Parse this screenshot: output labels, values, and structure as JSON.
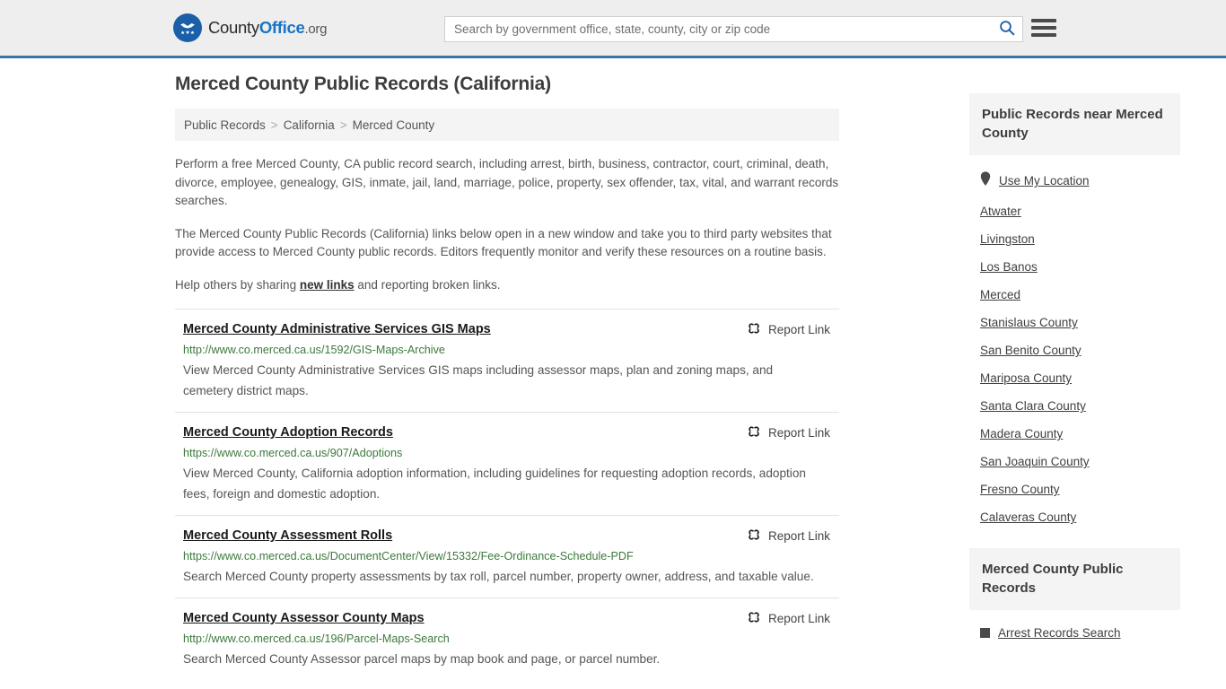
{
  "header": {
    "logo": {
      "part1": "County",
      "part2": "Office",
      "part3": ".org",
      "icon": "eagle-shield-logo-icon"
    },
    "search": {
      "placeholder": "Search by government office, state, county, city or zip code",
      "value": "",
      "button_icon": "search-icon"
    },
    "menu_icon": "hamburger-menu-icon",
    "accent_color": "#3a74a8",
    "background_color": "#eeeeee"
  },
  "main": {
    "title": "Merced County Public Records (California)",
    "breadcrumb": {
      "items": [
        "Public Records",
        "California",
        "Merced County"
      ],
      "separator": ">"
    },
    "intro_paragraph_1": "Perform a free Merced County, CA public record search, including arrest, birth, business, contractor, court, criminal, death, divorce, employee, genealogy, GIS, inmate, jail, land, marriage, police, property, sex offender, tax, vital, and warrant records searches.",
    "intro_paragraph_2": "The Merced County Public Records (California) links below open in a new window and take you to third party websites that provide access to Merced County public records. Editors frequently monitor and verify these resources on a routine basis.",
    "help_prefix": "Help others by sharing ",
    "help_link": "new links",
    "help_suffix": " and reporting broken links.",
    "report_link_label": "Report Link",
    "report_link_icon": "broken-chain-icon",
    "records": [
      {
        "title": "Merced County Administrative Services GIS Maps",
        "url": "http://www.co.merced.ca.us/1592/GIS-Maps-Archive",
        "description": "View Merced County Administrative Services GIS maps including assessor maps, plan and zoning maps, and cemetery district maps."
      },
      {
        "title": "Merced County Adoption Records",
        "url": "https://www.co.merced.ca.us/907/Adoptions",
        "description": "View Merced County, California adoption information, including guidelines for requesting adoption records, adoption fees, foreign and domestic adoption."
      },
      {
        "title": "Merced County Assessment Rolls",
        "url": "https://www.co.merced.ca.us/DocumentCenter/View/15332/Fee-Ordinance-Schedule-PDF",
        "description": "Search Merced County property assessments by tax roll, parcel number, property owner, address, and taxable value."
      },
      {
        "title": "Merced County Assessor County Maps",
        "url": "http://www.co.merced.ca.us/196/Parcel-Maps-Search",
        "description": "Search Merced County Assessor parcel maps by map book and page, or parcel number."
      }
    ]
  },
  "sidebar": {
    "nearby": {
      "title": "Public Records near Merced County",
      "use_my_location": "Use My Location",
      "location_icon": "map-pin-icon",
      "places": [
        "Atwater",
        "Livingston",
        "Los Banos",
        "Merced",
        "Stanislaus County",
        "San Benito County",
        "Mariposa County",
        "Santa Clara County",
        "Madera County",
        "San Joaquin County",
        "Fresno County",
        "Calaveras County"
      ]
    },
    "records_box": {
      "title": "Merced County Public Records",
      "items": [
        "Arrest Records Search"
      ],
      "bullet_icon": "square-bullet-icon"
    }
  }
}
